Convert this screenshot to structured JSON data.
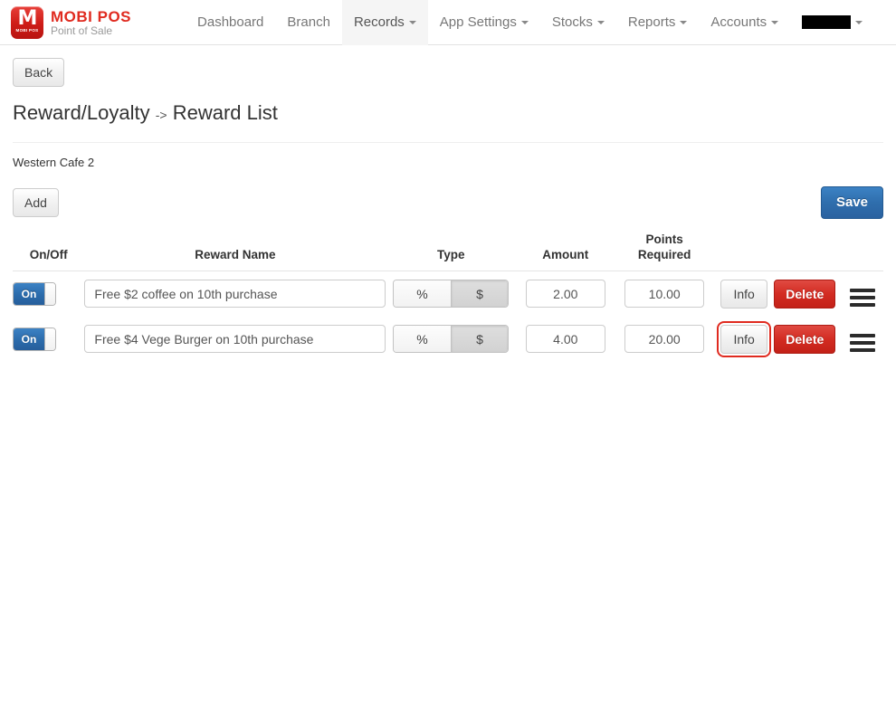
{
  "brand": {
    "logo_icon": "mobi-pos-logo-icon",
    "logo_mark_letter": "M",
    "logo_mark_caption": "MOBI POS",
    "title": "MOBI POS",
    "subtitle": "Point of Sale"
  },
  "nav": {
    "items": [
      {
        "label": "Dashboard",
        "has_caret": false,
        "active": false
      },
      {
        "label": "Branch",
        "has_caret": false,
        "active": false
      },
      {
        "label": "Records",
        "has_caret": true,
        "active": true
      },
      {
        "label": "App Settings",
        "has_caret": true,
        "active": false
      },
      {
        "label": "Stocks",
        "has_caret": true,
        "active": false
      },
      {
        "label": "Reports",
        "has_caret": true,
        "active": false
      },
      {
        "label": "Accounts",
        "has_caret": true,
        "active": false
      }
    ],
    "account_redacted": true
  },
  "page": {
    "back_label": "Back",
    "title_main": "Reward/Loyalty",
    "title_arrow": "->",
    "title_sub": "Reward List",
    "branch_name": "Western Cafe 2",
    "add_label": "Add",
    "save_label": "Save"
  },
  "table": {
    "headers": {
      "onoff": "On/Off",
      "reward_name": "Reward Name",
      "type": "Type",
      "amount": "Amount",
      "points_required_line1": "Points",
      "points_required_line2": "Required"
    },
    "type_options": {
      "percent": "%",
      "dollar": "$"
    },
    "actions": {
      "info": "Info",
      "delete": "Delete"
    },
    "drag_icon": "drag-handle-icon",
    "rows": [
      {
        "enabled_label": "On",
        "enabled": true,
        "name": "Free $2 coffee on 10th purchase",
        "type_selected": "$",
        "amount": "2.00",
        "points_required": "10.00",
        "info_focused": false
      },
      {
        "enabled_label": "On",
        "enabled": true,
        "name": "Free $4 Vege Burger on 10th purchase",
        "type_selected": "$",
        "amount": "4.00",
        "points_required": "20.00",
        "info_focused": true
      }
    ]
  },
  "colors": {
    "brand_red": "#e02b20",
    "primary_blue": "#2f6ead",
    "danger_red": "#d32c22",
    "focus_outline": "#e02b20",
    "nav_active_bg": "#f5f5f5"
  }
}
